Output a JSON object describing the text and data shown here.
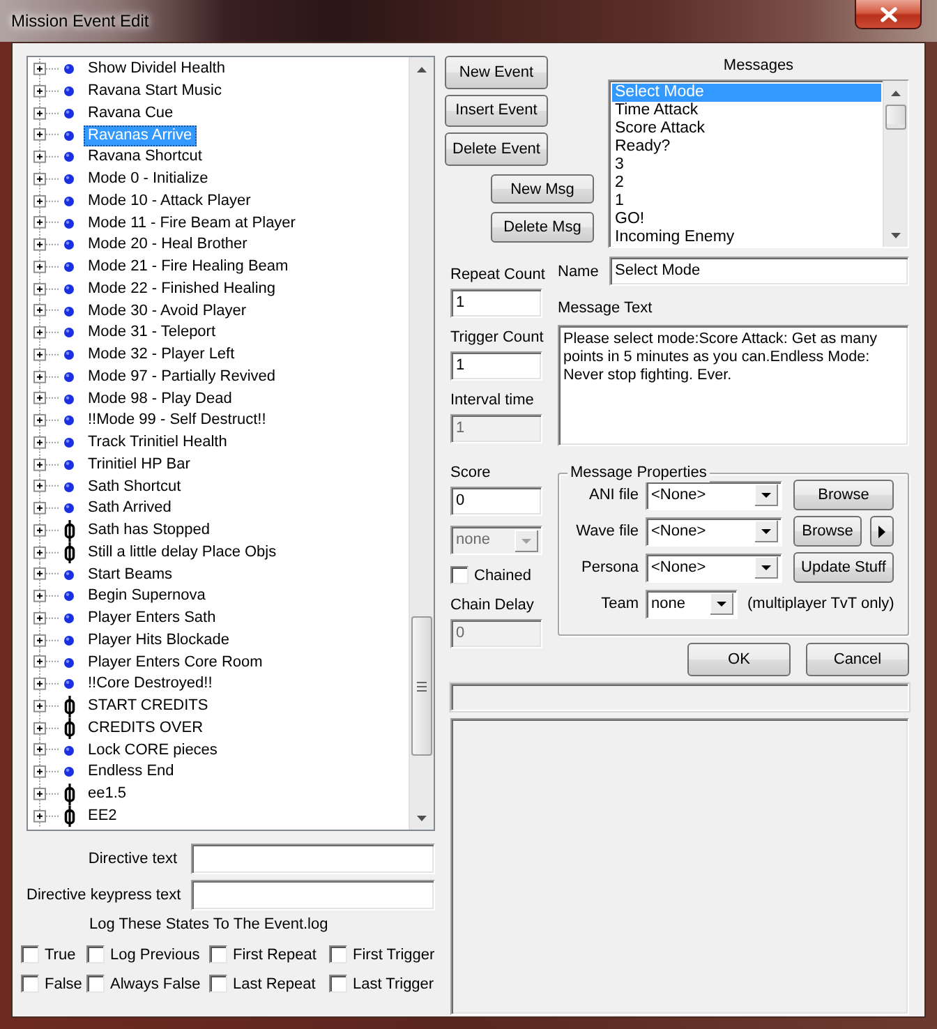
{
  "window": {
    "title": "Mission Event Edit"
  },
  "event_tree": {
    "items": [
      {
        "label": "Show Dividel Health",
        "kind": "dot",
        "selected": false
      },
      {
        "label": "Ravana Start Music",
        "kind": "dot",
        "selected": false
      },
      {
        "label": "Ravana Cue",
        "kind": "dot",
        "selected": false
      },
      {
        "label": "Ravanas Arrive",
        "kind": "dot",
        "selected": true
      },
      {
        "label": "Ravana Shortcut",
        "kind": "dot",
        "selected": false
      },
      {
        "label": "Mode 0 - Initialize",
        "kind": "dot",
        "selected": false
      },
      {
        "label": "Mode 10 - Attack Player",
        "kind": "dot",
        "selected": false
      },
      {
        "label": "Mode 11 - Fire Beam at Player",
        "kind": "dot",
        "selected": false
      },
      {
        "label": "Mode 20 - Heal Brother",
        "kind": "dot",
        "selected": false
      },
      {
        "label": "Mode 21 - Fire Healing Beam",
        "kind": "dot",
        "selected": false
      },
      {
        "label": "Mode 22 - Finished Healing",
        "kind": "dot",
        "selected": false
      },
      {
        "label": "Mode 30 - Avoid Player",
        "kind": "dot",
        "selected": false
      },
      {
        "label": "Mode 31 - Teleport",
        "kind": "dot",
        "selected": false
      },
      {
        "label": "Mode 32 - Player Left",
        "kind": "dot",
        "selected": false
      },
      {
        "label": "Mode 97 - Partially Revived",
        "kind": "dot",
        "selected": false
      },
      {
        "label": "Mode 98 - Play Dead",
        "kind": "dot",
        "selected": false
      },
      {
        "label": "!!Mode 99 - Self Destruct!!",
        "kind": "dot",
        "selected": false
      },
      {
        "label": "Track Trinitiel Health",
        "kind": "dot",
        "selected": false
      },
      {
        "label": "Trinitiel HP Bar",
        "kind": "dot",
        "selected": false
      },
      {
        "label": "Sath Shortcut",
        "kind": "dot",
        "selected": false
      },
      {
        "label": "Sath Arrived",
        "kind": "dot",
        "selected": false
      },
      {
        "label": "Sath has Stopped",
        "kind": "chain",
        "selected": false
      },
      {
        "label": "Still a little delay Place Objs",
        "kind": "chain",
        "selected": false
      },
      {
        "label": "Start Beams",
        "kind": "dot",
        "selected": false
      },
      {
        "label": "Begin Supernova",
        "kind": "dot",
        "selected": false
      },
      {
        "label": "Player Enters Sath",
        "kind": "dot",
        "selected": false
      },
      {
        "label": "Player Hits Blockade",
        "kind": "dot",
        "selected": false
      },
      {
        "label": "Player  Enters Core Room",
        "kind": "dot",
        "selected": false
      },
      {
        "label": "!!Core Destroyed!!",
        "kind": "dot",
        "selected": false
      },
      {
        "label": "START CREDITS",
        "kind": "chain",
        "selected": false
      },
      {
        "label": "CREDITS OVER",
        "kind": "chain",
        "selected": false
      },
      {
        "label": "Lock CORE pieces",
        "kind": "dot",
        "selected": false
      },
      {
        "label": "Endless End",
        "kind": "dot",
        "selected": false
      },
      {
        "label": "ee1.5",
        "kind": "chain",
        "selected": false
      },
      {
        "label": "EE2",
        "kind": "chain",
        "selected": false
      }
    ]
  },
  "directive_fields": [
    {
      "label": "Directive text"
    },
    {
      "label": "Directive keypress text"
    }
  ],
  "log_states": {
    "title": "Log These States To The Event.log",
    "options": [
      {
        "label": "True",
        "checked": false
      },
      {
        "label": "Log Previous",
        "checked": false
      },
      {
        "label": "First Repeat",
        "checked": false
      },
      {
        "label": "First Trigger",
        "checked": false
      },
      {
        "label": "False",
        "checked": false
      },
      {
        "label": "Always False",
        "checked": false
      },
      {
        "label": "Last Repeat",
        "checked": false
      },
      {
        "label": "Last Trigger",
        "checked": false
      }
    ]
  },
  "event_buttons": [
    "New Event",
    "Insert Event",
    "Delete Event"
  ],
  "message_buttons": [
    "New Msg",
    "Delete Msg"
  ],
  "messages": {
    "title": "Messages",
    "items": [
      {
        "label": "Select Mode",
        "selected": true
      },
      {
        "label": "Time Attack",
        "selected": false
      },
      {
        "label": "Score Attack",
        "selected": false
      },
      {
        "label": "Ready?",
        "selected": false
      },
      {
        "label": "3",
        "selected": false
      },
      {
        "label": "2",
        "selected": false
      },
      {
        "label": "1",
        "selected": false
      },
      {
        "label": "GO!",
        "selected": false
      },
      {
        "label": "Incoming Enemy",
        "selected": false
      }
    ]
  },
  "counts": [
    {
      "label": "Repeat Count",
      "value": "1",
      "disabled": false
    },
    {
      "label": "Trigger Count",
      "value": "1",
      "disabled": false
    },
    {
      "label": "Interval time",
      "value": "1",
      "disabled": true
    }
  ],
  "scoring": [
    {
      "kind": "field",
      "label": "Score",
      "value": "0",
      "disabled": false
    },
    {
      "kind": "dropdown",
      "value": "none",
      "disabled": true
    },
    {
      "kind": "checkbox",
      "label": "Chained",
      "checked": false
    },
    {
      "kind": "field",
      "label": "Chain Delay",
      "value": "0",
      "disabled": true
    }
  ],
  "name_field": {
    "label": "Name",
    "value": "Select Mode"
  },
  "message_text": {
    "label": "Message Text",
    "value": "Please select mode:Score Attack: Get as many points in 5 minutes as you can.Endless Mode: Never stop fighting. Ever."
  },
  "message_properties": {
    "title": "Message Properties",
    "rows": [
      {
        "label": "ANI file",
        "value": "<None>",
        "buttons": [
          {
            "kind": "text",
            "label": "Browse"
          }
        ]
      },
      {
        "label": "Wave file",
        "value": "<None>",
        "buttons": [
          {
            "kind": "text",
            "label": "Browse"
          },
          {
            "kind": "play"
          }
        ]
      },
      {
        "label": "Persona",
        "value": "<None>",
        "buttons": [
          {
            "kind": "text",
            "label": "Update Stuff"
          }
        ]
      },
      {
        "label": "Team",
        "value": "none",
        "note": "(multiplayer TvT only)"
      }
    ]
  },
  "dialog_buttons": [
    "OK",
    "Cancel"
  ]
}
